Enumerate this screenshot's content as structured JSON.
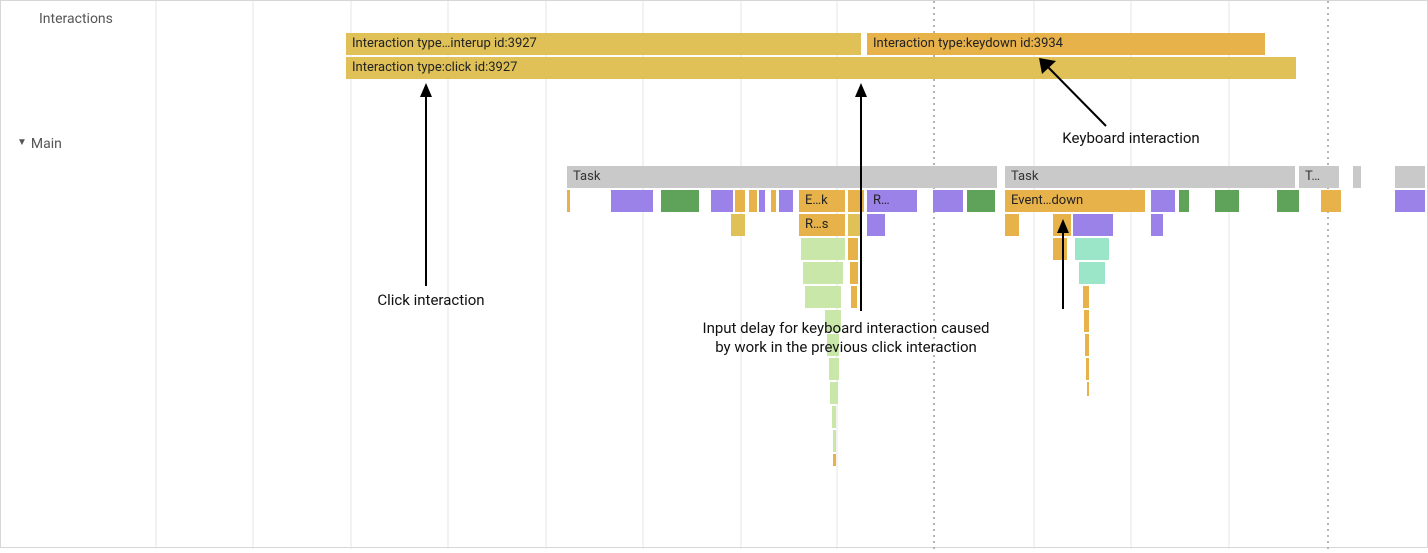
{
  "tracks": {
    "interactions_label": "Interactions",
    "main_label": "Main"
  },
  "interactions": {
    "pointerup": "Interaction type…interup id:3927",
    "click": "Interaction type:click id:3927",
    "keydown": "Interaction type:keydown id:3934"
  },
  "tasks": {
    "task1": "Task",
    "task2": "Task",
    "task3": "T…"
  },
  "events": {
    "ek": "E…k",
    "rdots": "R…",
    "rs": "R…s",
    "eventdown": "Event…down"
  },
  "annotations": {
    "click": "Click interaction",
    "keyboard": "Keyboard interaction",
    "input_delay": "Input delay for keyboard interaction caused by work in the previous click interaction"
  },
  "colors": {
    "interaction_primary": "#dfc157",
    "interaction_secondary": "#e8b24a",
    "task": "#c9c9c9",
    "scripting": "#e8b24a",
    "rendering": "#9a82e8",
    "painting": "#5fa35a"
  }
}
